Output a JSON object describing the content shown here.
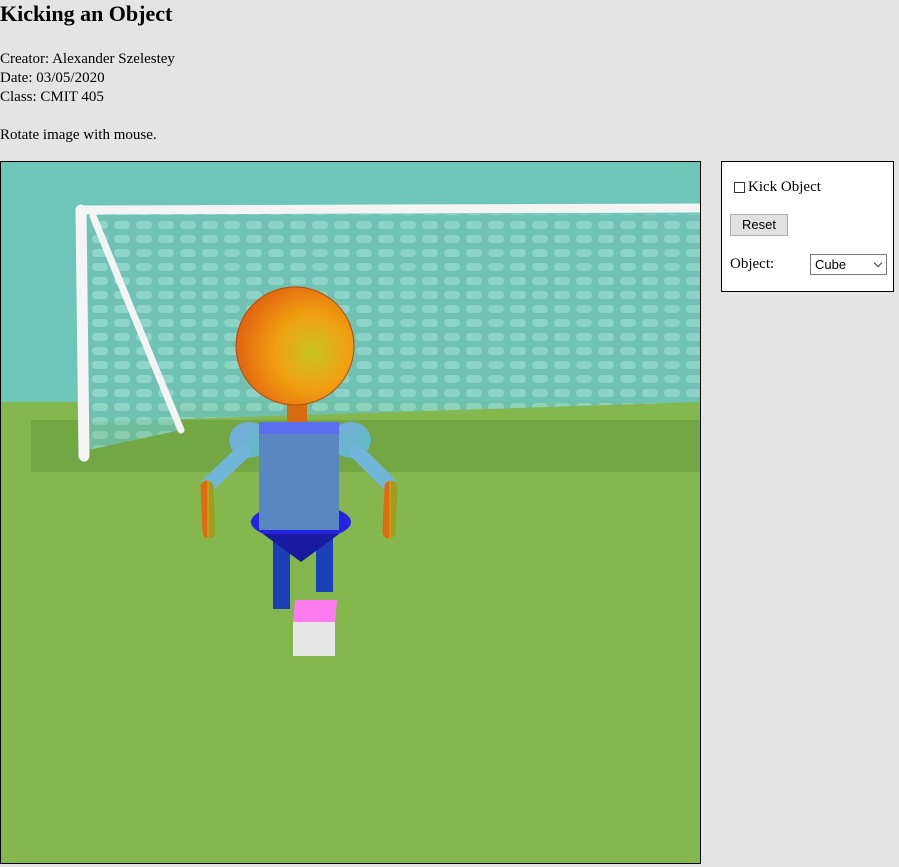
{
  "page": {
    "title": "Kicking an Object",
    "creator": "Creator: Alexander Szelestey",
    "date": "Date: 03/05/2020",
    "class_info": "Class: CMIT 405",
    "instruction": "Rotate image with mouse."
  },
  "controls": {
    "kick_label": "Kick Object",
    "kick_checked": false,
    "reset_label": "Reset",
    "object_label": "Object:",
    "object_selected": "Cube"
  },
  "scene": {
    "sky_color": "#6dc6b8",
    "field_color": "#84b84e",
    "ball_object": "cube",
    "colors": {
      "head": "#f07a10",
      "torso": "#5b87c0",
      "arms_upper": "#6e98cf",
      "forearms": "#e08a16",
      "skirt": "#2424e0",
      "legs": "#1a3fb8",
      "cube_top": "#ff7cf0",
      "cube_side": "#e6e6e6"
    }
  }
}
